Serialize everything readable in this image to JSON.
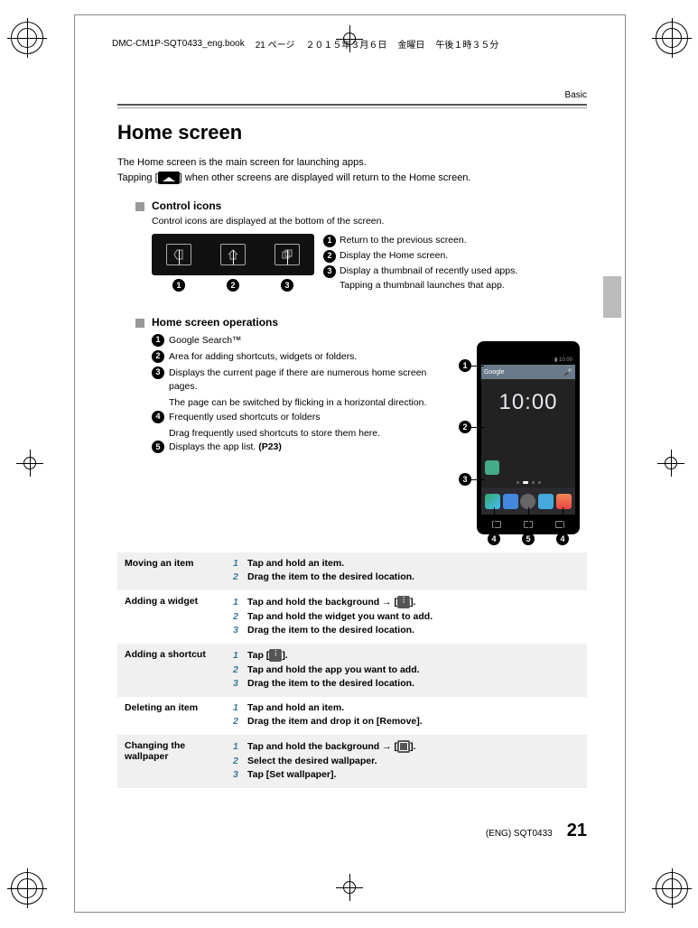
{
  "print_header": {
    "filename": "DMC-CM1P-SQT0433_eng.book",
    "page_info": "21 ページ",
    "date": "２０１５年３月６日",
    "weekday": "金曜日",
    "time": "午後１時３５分"
  },
  "section": "Basic",
  "title": "Home screen",
  "intro_1": "The Home screen is the main screen for launching apps.",
  "intro_2a": "Tapping [",
  "intro_2b": "] when other screens are displayed will return to the Home screen.",
  "control_icons": {
    "heading": "Control icons",
    "desc": "Control icons are displayed at the bottom of the screen.",
    "items": [
      "Return to the previous screen.",
      "Display the Home screen.",
      "Display a thumbnail of recently used apps.",
      "Tapping a thumbnail launches that app."
    ]
  },
  "home_ops": {
    "heading": "Home screen operations",
    "items": [
      {
        "text": "Google Search™"
      },
      {
        "text": "Area for adding shortcuts, widgets or folders."
      },
      {
        "text": "Displays the current page if there are numerous home screen pages.",
        "sub": "The page can be switched by flicking in a horizontal direction."
      },
      {
        "text": "Frequently used shortcuts or folders",
        "sub": "Drag frequently used shortcuts to store them here."
      },
      {
        "text": "Displays the app list.",
        "ref": "(P23)"
      }
    ]
  },
  "phone": {
    "status_time": "10:00",
    "clock": "10:00",
    "search_label": "Google"
  },
  "table": [
    {
      "label": "Moving an item",
      "steps": [
        "Tap and hold an item.",
        "Drag the item to the desired location."
      ]
    },
    {
      "label": "Adding a widget",
      "steps": [
        "Tap and hold the background → [ICON_GRID].",
        "Tap and hold the widget you want to add.",
        "Drag the item to the desired location."
      ]
    },
    {
      "label": "Adding a shortcut",
      "steps": [
        "Tap [ICON_GRID].",
        "Tap and hold the app you want to add.",
        "Drag the item to the desired location."
      ]
    },
    {
      "label": "Deleting an item",
      "steps": [
        "Tap and hold an item.",
        "Drag the item and drop it on [Remove]."
      ]
    },
    {
      "label": "Changing the wallpaper",
      "steps": [
        "Tap and hold the background → [ICON_PIC].",
        "Select the desired wallpaper.",
        "Tap [Set wallpaper]."
      ]
    }
  ],
  "footer": {
    "doc_code": "(ENG) SQT0433",
    "page": "21"
  }
}
